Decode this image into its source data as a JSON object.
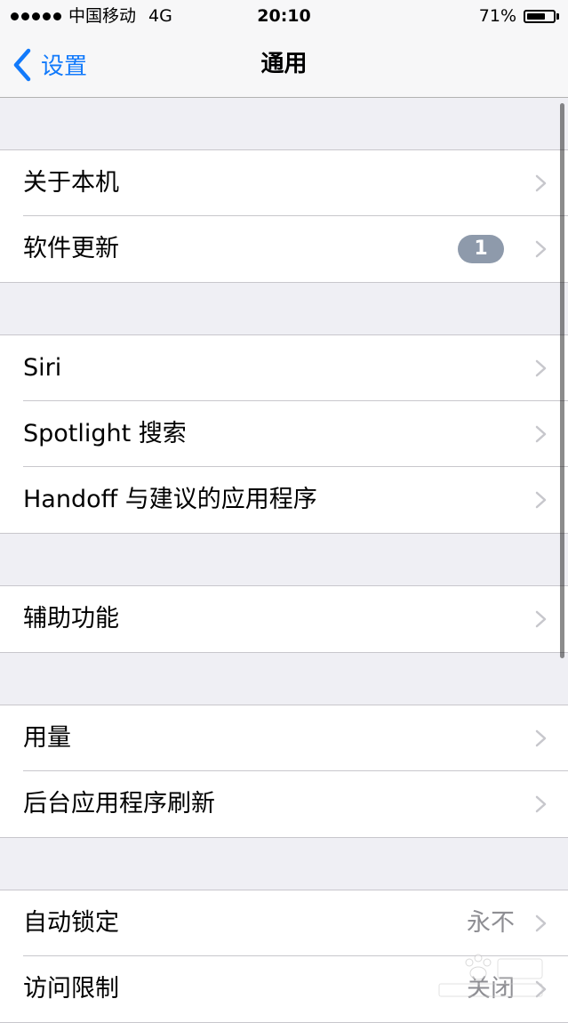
{
  "status_bar": {
    "carrier": "中国移动",
    "network": "4G",
    "time": "20:10",
    "battery_percent": "71%",
    "battery_level": 0.71,
    "signal_bars": 5
  },
  "nav_bar": {
    "back_label": "设置",
    "title": "通用"
  },
  "groups": [
    {
      "items": [
        {
          "label": "关于本机"
        },
        {
          "label": "软件更新",
          "badge": "1"
        }
      ]
    },
    {
      "items": [
        {
          "label": "Siri"
        },
        {
          "label": "Spotlight 搜索"
        },
        {
          "label": "Handoff 与建议的应用程序"
        }
      ]
    },
    {
      "items": [
        {
          "label": "辅助功能"
        }
      ]
    },
    {
      "items": [
        {
          "label": "用量"
        },
        {
          "label": "后台应用程序刷新"
        }
      ]
    },
    {
      "items": [
        {
          "label": "自动锁定",
          "value": "永不"
        },
        {
          "label": "访问限制",
          "value": "关闭"
        }
      ]
    }
  ],
  "colors": {
    "accent": "#127afb",
    "background": "#efeff4",
    "badge": "#8e9aab",
    "separator": "#c8c7cc",
    "secondary_text": "#8e8e93"
  },
  "icons": {
    "back": "chevron-left-icon",
    "disclosure": "chevron-right-icon",
    "battery": "battery-icon",
    "signal": "signal-dots-icon"
  }
}
